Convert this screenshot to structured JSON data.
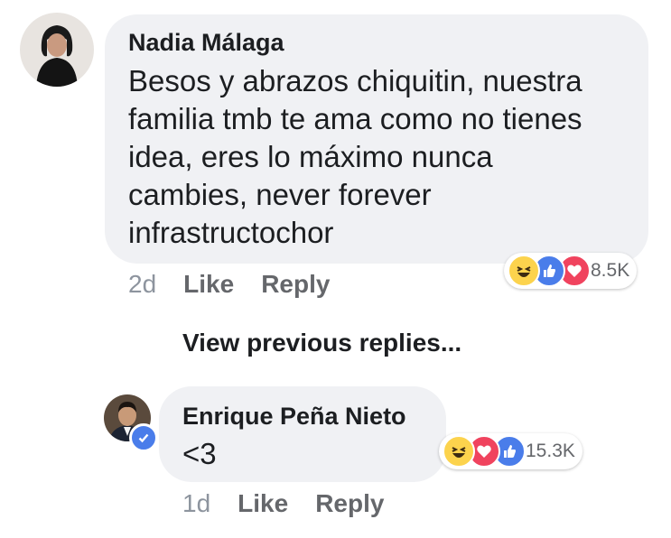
{
  "comment1": {
    "author": "Nadia Málaga",
    "text": "Besos y abrazos chiquitin, nuestra\nfamilia tmb te ama como no tienes\nidea, eres lo máximo nunca\ncambies, never forever\ninfrastructochor",
    "time": "2d",
    "like": "Like",
    "reply": "Reply",
    "reaction_icons": [
      "haha-icon",
      "like-icon",
      "love-icon"
    ],
    "reaction_count": "8.5K"
  },
  "view_previous": "View previous replies...",
  "comment2": {
    "author": "Enrique Peña Nieto",
    "text": "<3",
    "time": "1d",
    "like": "Like",
    "reply": "Reply",
    "verified": true,
    "reaction_icons": [
      "haha-icon",
      "love-icon",
      "like-icon"
    ],
    "reaction_count": "15.3K"
  },
  "colors": {
    "like": "#4a7dea",
    "love": "#f0435e",
    "haha": "#fcd34d",
    "bubble": "#f0f1f4"
  }
}
